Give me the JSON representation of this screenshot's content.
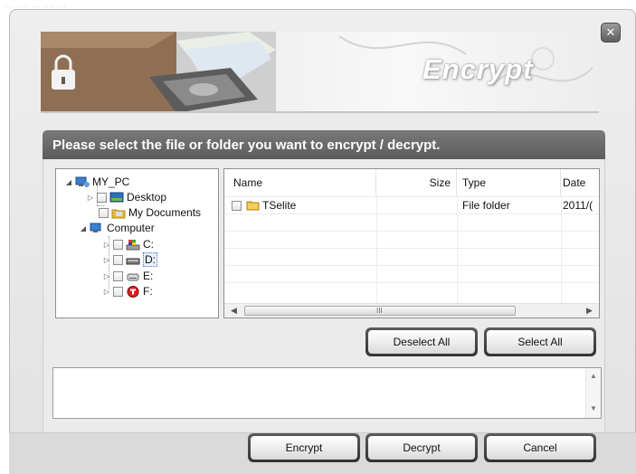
{
  "titlebar_text": "... .... ... ....  ...",
  "window": {
    "close_icon": "close-icon",
    "banner_title": "Encrypt"
  },
  "panel": {
    "instruction": "Please select the file or folder you want to encrypt / decrypt."
  },
  "tree": {
    "root": "MY_PC",
    "desktop": "Desktop",
    "my_documents": "My Documents",
    "computer": "Computer",
    "drives": [
      "C:",
      "D:",
      "E:",
      "F:"
    ],
    "selected_drive": "D:"
  },
  "file_list": {
    "columns": [
      "Name",
      "Size",
      "Type",
      "Date"
    ],
    "rows": [
      {
        "name": "TSelite",
        "size": "",
        "type": "File folder",
        "date": "2011/("
      }
    ],
    "scroll_grip": "III"
  },
  "buttons": {
    "deselect_all": "Deselect All",
    "select_all": "Select All",
    "encrypt": "Encrypt",
    "decrypt": "Decrypt",
    "cancel": "Cancel"
  },
  "colors": {
    "header_bg": "#6a6a6a",
    "folder_yellow": "#e8b83a",
    "window_bg": "#e6e6e6"
  }
}
